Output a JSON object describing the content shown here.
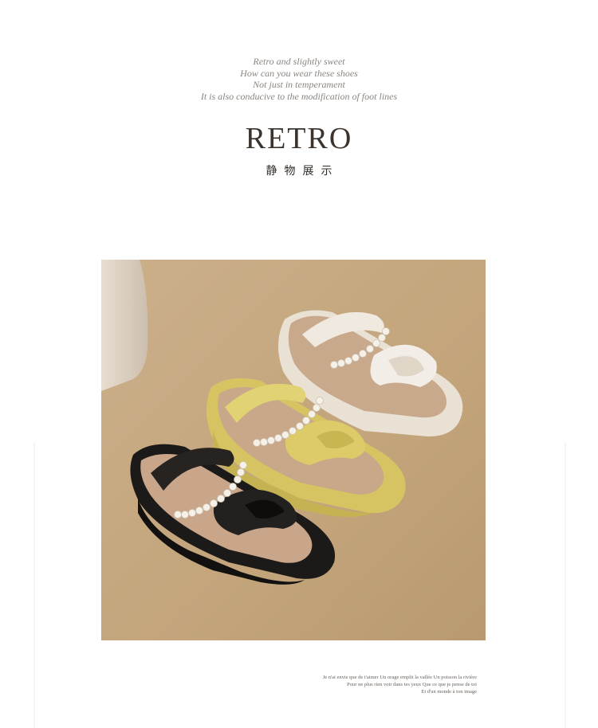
{
  "intro_lines": [
    "Retro and slightly sweet",
    "How can you wear these shoes",
    "Not just in temperament",
    "It is also conducive to the modification of foot lines"
  ],
  "title": "RETRO",
  "subtitle": "静物展示",
  "footnote_lines": [
    "Je n'ai envie que de t'aimer Un orage emplit la vallée Un poisson la rivière",
    "Pour ne plus rien voir dans tes yeux Que ce que je pense de toi",
    "Et d'un monde à ton image"
  ],
  "colors": {
    "background": "#ffffff",
    "photo_backdrop": "#c3a57d",
    "sandal_black": "#1c1a18",
    "sandal_yellow": "#d8c765",
    "sandal_cream": "#ece4d8",
    "pearl": "#f4efe6"
  }
}
